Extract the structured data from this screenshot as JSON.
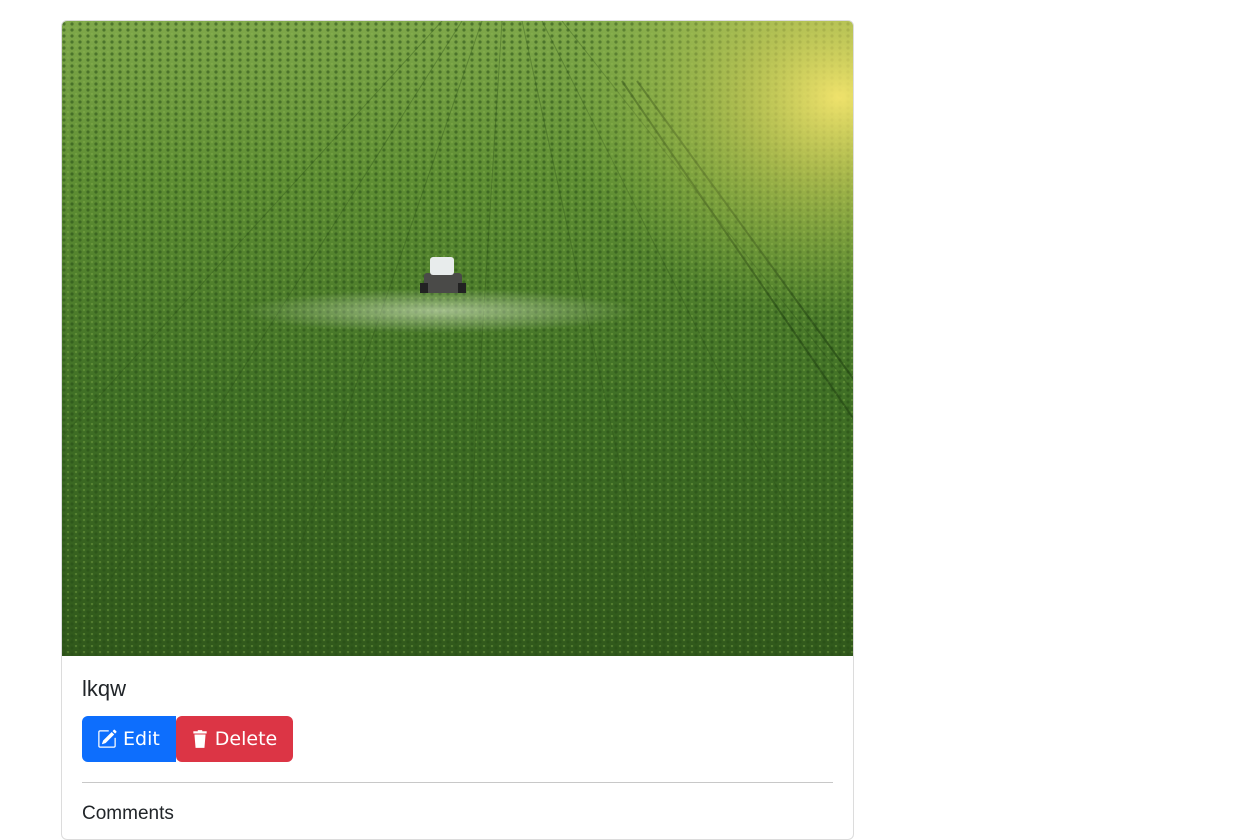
{
  "post": {
    "image_alt": "Aerial view of a tractor spraying a green crop field",
    "title": "lkqw",
    "edit_label": "Edit",
    "delete_label": "Delete",
    "comments_heading": "Comments"
  },
  "icons": {
    "edit": "pencil-square-icon",
    "delete": "trash-icon"
  },
  "colors": {
    "primary": "#0d6efd",
    "danger": "#dc3545",
    "field_dark": "#2e5a1c",
    "field_light": "#6f9a3a",
    "sun": "#f3e27a"
  }
}
